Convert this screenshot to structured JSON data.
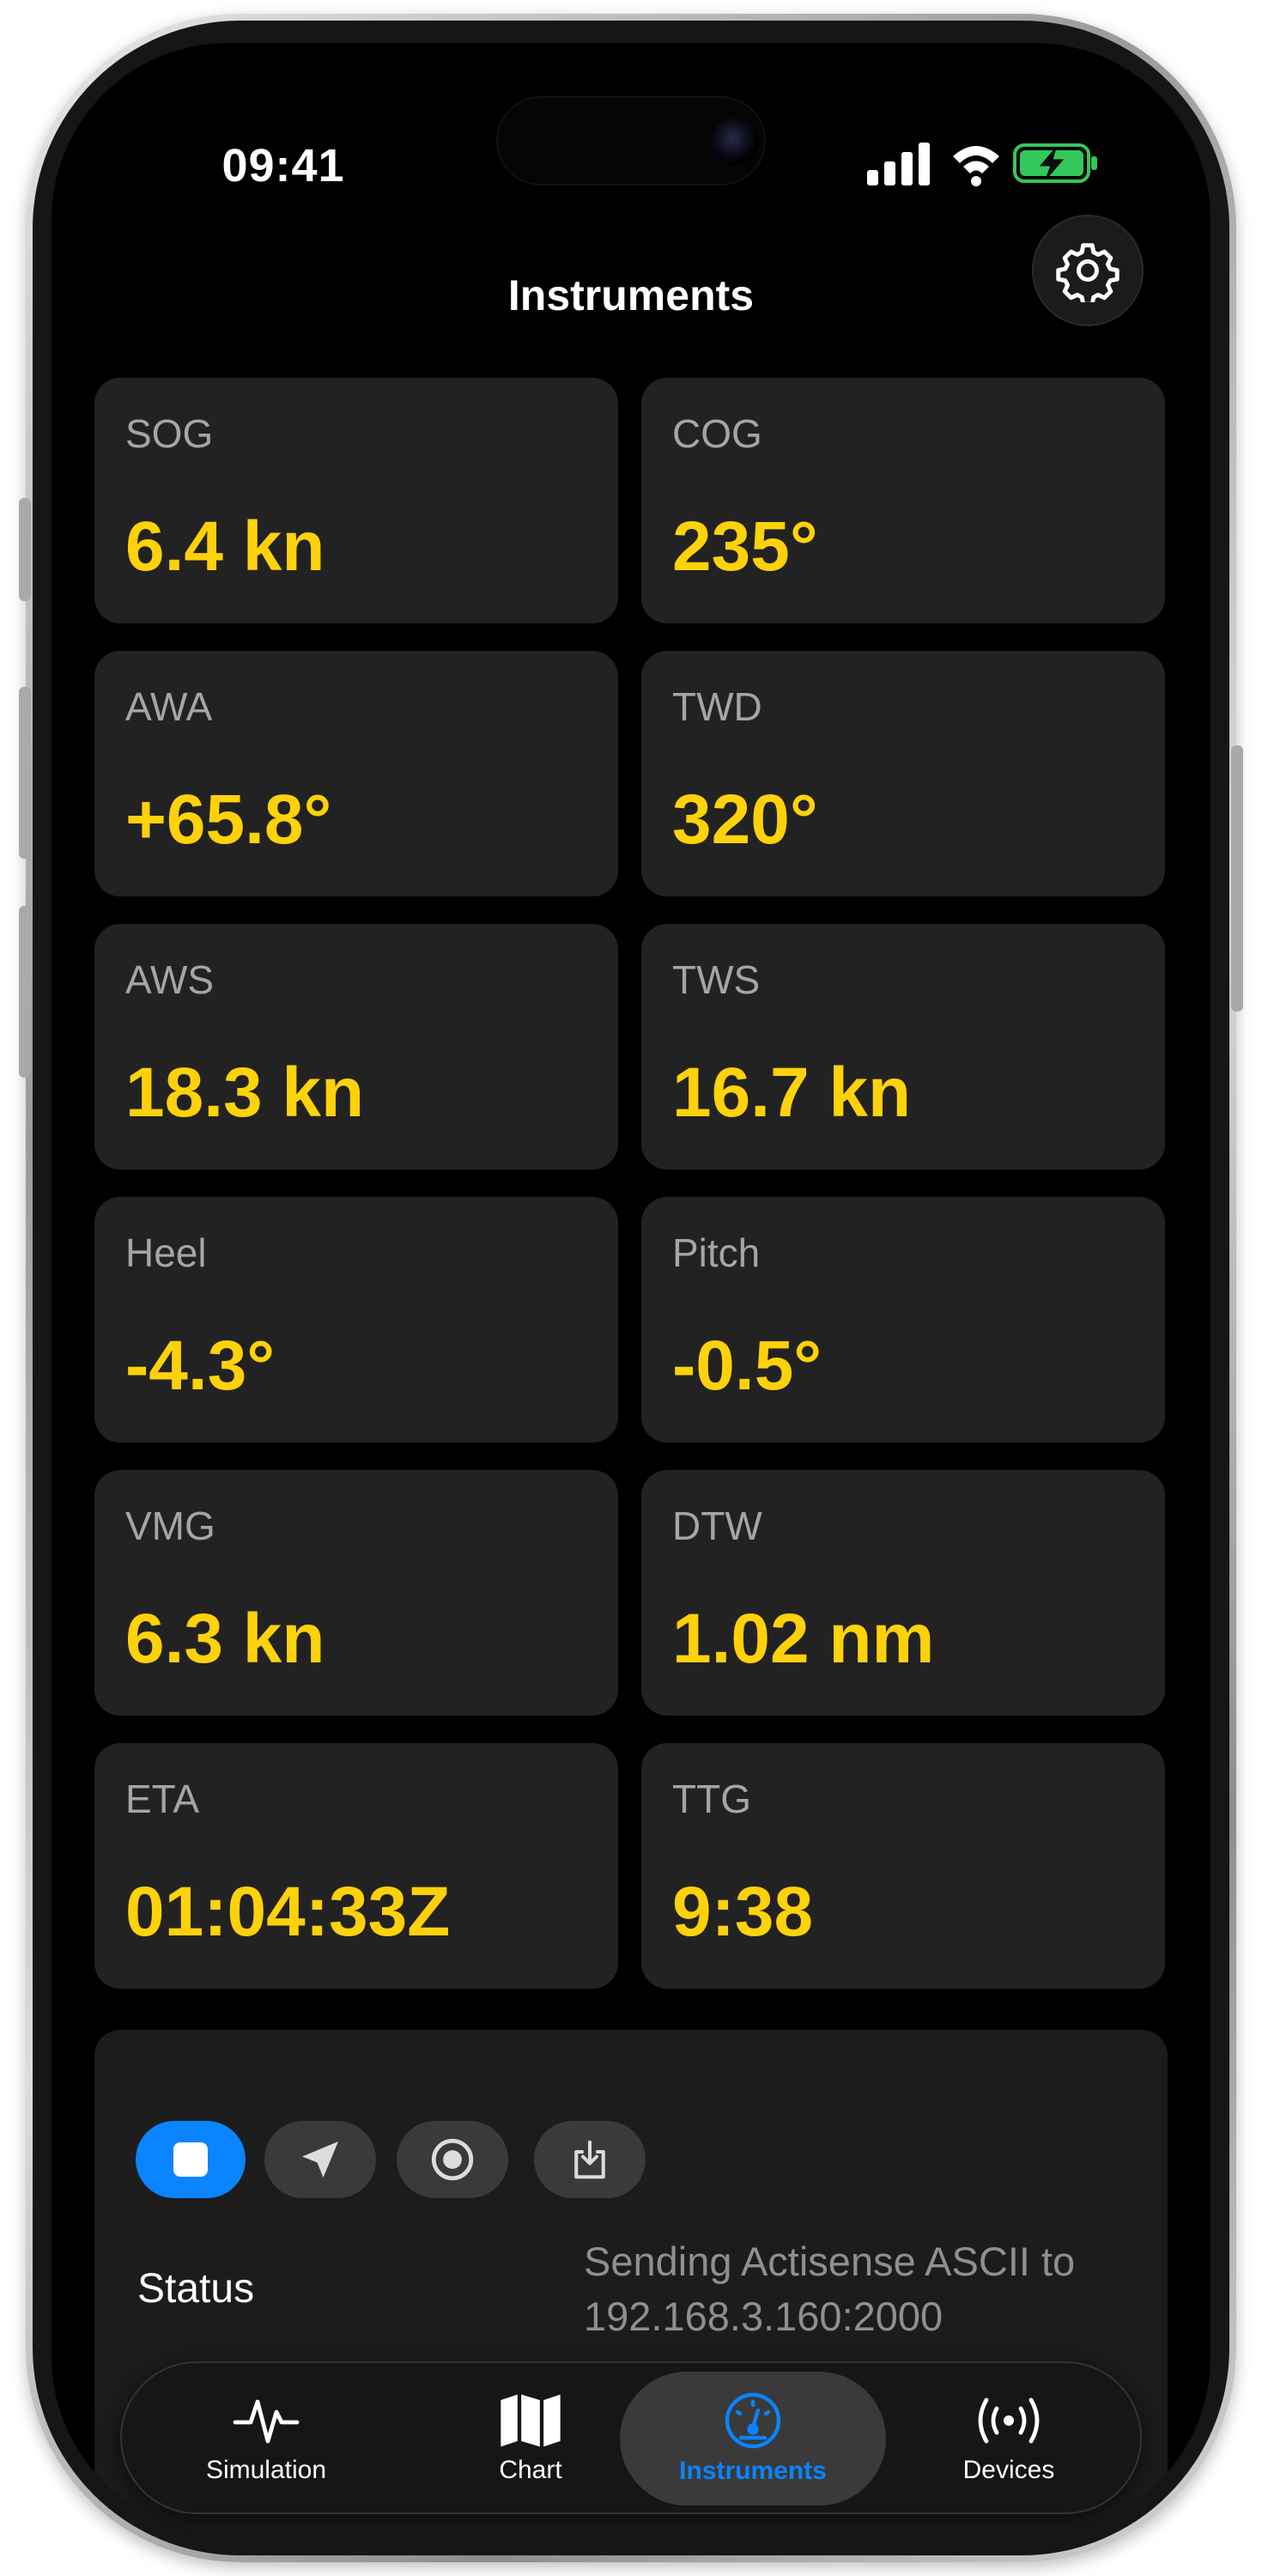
{
  "status_bar": {
    "time": "09:41"
  },
  "header": {
    "title": "Instruments"
  },
  "tiles": [
    {
      "label": "SOG",
      "value": "6.4 kn"
    },
    {
      "label": "COG",
      "value": "235°"
    },
    {
      "label": "AWA",
      "value": "+65.8°"
    },
    {
      "label": "TWD",
      "value": "320°"
    },
    {
      "label": "AWS",
      "value": "18.3 kn"
    },
    {
      "label": "TWS",
      "value": "16.7 kn"
    },
    {
      "label": "Heel",
      "value": "-4.3°"
    },
    {
      "label": "Pitch",
      "value": "-0.5°"
    },
    {
      "label": "VMG",
      "value": "6.3 kn"
    },
    {
      "label": "DTW",
      "value": "1.02 nm"
    },
    {
      "label": "ETA",
      "value": "01:04:33Z"
    },
    {
      "label": "TTG",
      "value": "9:38"
    }
  ],
  "controls": {
    "status_label": "Status",
    "status_value": "Sending Actisense ASCII to 192.168.3.160:2000"
  },
  "tabbar": {
    "items": [
      {
        "label": "Simulation",
        "icon": "waveform-icon"
      },
      {
        "label": "Chart",
        "icon": "map-icon"
      },
      {
        "label": "Instruments",
        "icon": "gauge-icon",
        "active": true
      },
      {
        "label": "Devices",
        "icon": "broadcast-icon"
      }
    ]
  },
  "colors": {
    "value": "#fdd20a",
    "accent": "#0a84ff",
    "tile_bg": "#222222",
    "background": "#000000"
  }
}
